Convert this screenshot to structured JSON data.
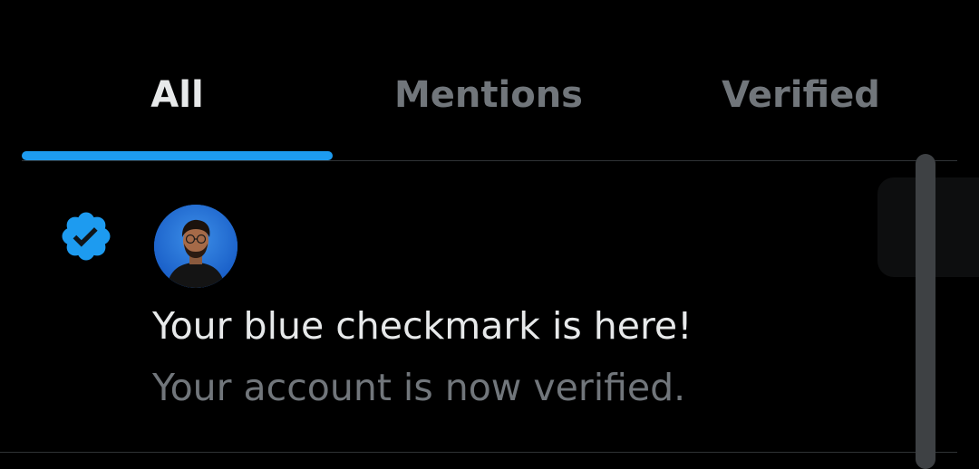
{
  "tabs": [
    {
      "label": "All",
      "active": true
    },
    {
      "label": "Mentions",
      "active": false
    },
    {
      "label": "Verified",
      "active": false
    }
  ],
  "notification": {
    "icon": "verified-badge-icon",
    "title": "Your blue checkmark is here!",
    "body": "Your account is now verified."
  },
  "colors": {
    "background": "#000000",
    "accent": "#1d9bf0",
    "primary_text": "#e7e9ea",
    "secondary_text": "#71767b",
    "divider": "#2f3336"
  }
}
